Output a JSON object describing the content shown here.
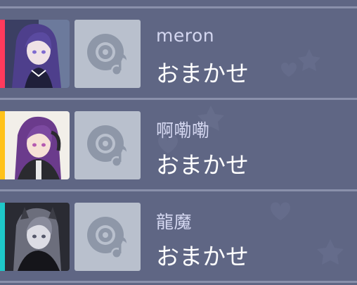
{
  "players": [
    {
      "name": "meron",
      "song": "おまかせ",
      "accent_color": "#ff3a5c",
      "avatar_icon": "character-portrait-icon",
      "song_icon": "music-disc-icon"
    },
    {
      "name": "啊嘞嘞",
      "song": "おまかせ",
      "accent_color": "#ffc21a",
      "avatar_icon": "character-portrait-icon",
      "song_icon": "music-disc-icon"
    },
    {
      "name": "龍魔",
      "song": "おまかせ",
      "accent_color": "#1ec9c9",
      "avatar_icon": "character-portrait-icon",
      "song_icon": "music-disc-icon"
    }
  ]
}
